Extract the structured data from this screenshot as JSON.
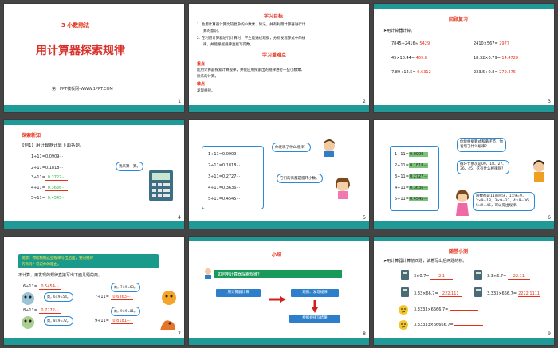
{
  "slides": {
    "s1": {
      "number": "1",
      "subtitle": "3  小数除法",
      "title": "用计算器探索规律",
      "footer": "第一PPT模板网-WWW.1PPT.COM"
    },
    "s2": {
      "number": "2",
      "heading1": "学习目标",
      "goal1_line1": "1. 会用计算器计算比较复杂的小数乘、除法，并有利用计算器进行计",
      "goal1_line2": "算的意识。",
      "goal2_line1": "2. 在利用计算器进行计算时，学生能通过观察，分析发现算式中的规",
      "goal2_line2": "律，并能根据规律直接写得数。",
      "heading2": "学习重难点",
      "key_label": "重点",
      "key_text1": "能用计算器探索计算规律，并能应用探索出的规律进行一些小数乘、",
      "key_text2": "除法的计算。",
      "diff_label": "难点",
      "diff_text": "发现规律。"
    },
    "s3": {
      "number": "3",
      "heading": "回顾复习",
      "intro": "➤用计算器计算。",
      "rows": [
        {
          "left_q": "7845÷2416≈",
          "left_a": "5429",
          "right_q": "2410×567=",
          "right_a": "2977"
        },
        {
          "left_q": "45×10.44=",
          "left_a": "469.8",
          "right_q": "18.32×0.79=",
          "right_a": "14.4728"
        },
        {
          "left_q": "7.89÷12.5=",
          "left_a": "0.6312",
          "right_q": "223.5÷0.8=",
          "right_a": "279.375"
        }
      ]
    },
    "s4": {
      "number": "4",
      "heading": "探索新知",
      "example": "【例1】用计算器计算下面各题。",
      "rows": [
        {
          "q": "1÷11=",
          "a": "0.0909···",
          "style": "black"
        },
        {
          "q": "2÷11=",
          "a": "0.1818···",
          "style": "black"
        },
        {
          "q": "3÷11=",
          "a": "0.2727···",
          "style": "green"
        },
        {
          "q": "4÷11=",
          "a": "0.3636···",
          "style": "green"
        },
        {
          "q": "5÷11=",
          "a": "0.4545···",
          "style": "green"
        }
      ],
      "speech": "我来算一算。"
    },
    "s5": {
      "number": "5",
      "rows": [
        "1÷11=0.0909···",
        "2÷11=0.1818···",
        "3÷11=0.2727···",
        "4÷11=0.3636···",
        "5÷11=0.4545···"
      ],
      "bubble1": "你发现了什么规律？",
      "bubble2": "它们的商都是循环小数。"
    },
    "s6": {
      "number": "6",
      "rows": [
        {
          "q": "1÷11=",
          "r": "0.0909···"
        },
        {
          "q": "2÷11=",
          "r": "0.1818···"
        },
        {
          "q": "3÷11=",
          "r": "0.2727···"
        },
        {
          "q": "4÷11=",
          "r": "0.3636···"
        },
        {
          "q": "5÷11=",
          "r": "0.4545···"
        }
      ],
      "bubble1_line1": "你能根据算式和循环节，你",
      "bubble1_line2": "发现了什么规律？",
      "bubble2_line1": "循环节依次是09、18、27、",
      "bubble2_line2": "36、45，这有什么规律呢？",
      "bubble3_line1": "除数都是11的除法，1×9=9，",
      "bubble3_line2": "2×9=18，3×9=27，4×9=36，",
      "bubble3_line3": "5×9=45，可以得出规律。"
    },
    "s7": {
      "number": "7",
      "banner_line1": "观察：你能根据这些规律写出后面，要的规律",
      "banner_line2": "的商吗？说说你的理由。",
      "instruction": "不计算，用发现的规律直接写出下面几题的商。",
      "left": [
        {
          "q": "6÷11=",
          "a": "0.5454···",
          "hint": "商，6×9=54。"
        },
        {
          "q": "8÷11=",
          "a": "0.7272···",
          "hint": "商，8×9=72。"
        }
      ],
      "right": [
        {
          "q": "7÷11=",
          "a": "0.6363···",
          "hint": "商，7×9=63。"
        },
        {
          "q": "9÷11=",
          "a": "0.8181···",
          "hint": "商，9×9=81。"
        }
      ]
    },
    "s8": {
      "number": "8",
      "heading": "小结",
      "question": "如何用计算器探索规律？",
      "step1": "用计算器计算",
      "step2": "观察、发现规律",
      "step3": "根据规律写结果"
    },
    "s9": {
      "number": "9",
      "heading": "随堂小测",
      "intro": "➤用计算器计算前四题，试着写出后两题的积。",
      "rows": [
        {
          "lq": "3×0.7=",
          "la": "2.1",
          "rq": "3.3×6.7=",
          "ra": "22.11"
        },
        {
          "lq": "3.33×66.7=",
          "la": "222.111",
          "rq": "3.333×666.7=",
          "ra": "2222.1111"
        }
      ],
      "extra": [
        "3.3333×6666.7=",
        "3.33333×66666.7="
      ]
    }
  },
  "colors": {
    "teal_bar": "#1f9a97",
    "accent_red": "#e5331b",
    "accent_green": "#2db34a",
    "accent_blue": "#2d7fcc"
  }
}
